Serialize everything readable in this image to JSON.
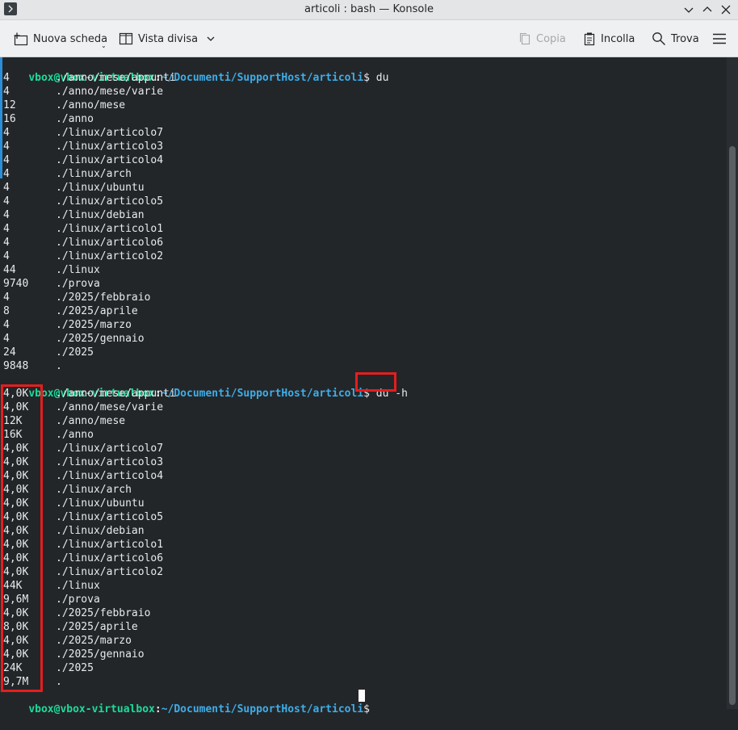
{
  "window": {
    "title": "articoli : bash — Konsole"
  },
  "toolbar": {
    "new_tab_label": "Nuova scheda",
    "split_view_label": "Vista divisa",
    "copy_label": "Copia",
    "paste_label": "Incolla",
    "find_label": "Trova"
  },
  "prompt": {
    "user_host": "vbox@vbox-virtualbox",
    "colon": ":",
    "path": "~/Documenti/SupportHost/articoli",
    "dollar": "$ "
  },
  "commands": {
    "first": "du",
    "second": "du -h"
  },
  "du_output": [
    {
      "size": "4",
      "path": "./anno/mese/appunti"
    },
    {
      "size": "4",
      "path": "./anno/mese/varie"
    },
    {
      "size": "12",
      "path": "./anno/mese"
    },
    {
      "size": "16",
      "path": "./anno"
    },
    {
      "size": "4",
      "path": "./linux/articolo7"
    },
    {
      "size": "4",
      "path": "./linux/articolo3"
    },
    {
      "size": "4",
      "path": "./linux/articolo4"
    },
    {
      "size": "4",
      "path": "./linux/arch"
    },
    {
      "size": "4",
      "path": "./linux/ubuntu"
    },
    {
      "size": "4",
      "path": "./linux/articolo5"
    },
    {
      "size": "4",
      "path": "./linux/debian"
    },
    {
      "size": "4",
      "path": "./linux/articolo1"
    },
    {
      "size": "4",
      "path": "./linux/articolo6"
    },
    {
      "size": "4",
      "path": "./linux/articolo2"
    },
    {
      "size": "44",
      "path": "./linux"
    },
    {
      "size": "9740",
      "path": "./prova"
    },
    {
      "size": "4",
      "path": "./2025/febbraio"
    },
    {
      "size": "8",
      "path": "./2025/aprile"
    },
    {
      "size": "4",
      "path": "./2025/marzo"
    },
    {
      "size": "4",
      "path": "./2025/gennaio"
    },
    {
      "size": "24",
      "path": "./2025"
    },
    {
      "size": "9848",
      "path": "."
    }
  ],
  "du_h_output": [
    {
      "size": "4,0K",
      "path": "./anno/mese/appunti"
    },
    {
      "size": "4,0K",
      "path": "./anno/mese/varie"
    },
    {
      "size": "12K",
      "path": "./anno/mese"
    },
    {
      "size": "16K",
      "path": "./anno"
    },
    {
      "size": "4,0K",
      "path": "./linux/articolo7"
    },
    {
      "size": "4,0K",
      "path": "./linux/articolo3"
    },
    {
      "size": "4,0K",
      "path": "./linux/articolo4"
    },
    {
      "size": "4,0K",
      "path": "./linux/arch"
    },
    {
      "size": "4,0K",
      "path": "./linux/ubuntu"
    },
    {
      "size": "4,0K",
      "path": "./linux/articolo5"
    },
    {
      "size": "4,0K",
      "path": "./linux/debian"
    },
    {
      "size": "4,0K",
      "path": "./linux/articolo1"
    },
    {
      "size": "4,0K",
      "path": "./linux/articolo6"
    },
    {
      "size": "4,0K",
      "path": "./linux/articolo2"
    },
    {
      "size": "44K",
      "path": "./linux"
    },
    {
      "size": "9,6M",
      "path": "./prova"
    },
    {
      "size": "4,0K",
      "path": "./2025/febbraio"
    },
    {
      "size": "8,0K",
      "path": "./2025/aprile"
    },
    {
      "size": "4,0K",
      "path": "./2025/marzo"
    },
    {
      "size": "4,0K",
      "path": "./2025/gennaio"
    },
    {
      "size": "24K",
      "path": "./2025"
    },
    {
      "size": "9,7M",
      "path": "."
    }
  ],
  "colors": {
    "terminal_bg": "#232629",
    "prompt_user": "#1cdc9a",
    "prompt_path": "#3daee9",
    "highlight": "#e41e1e"
  }
}
